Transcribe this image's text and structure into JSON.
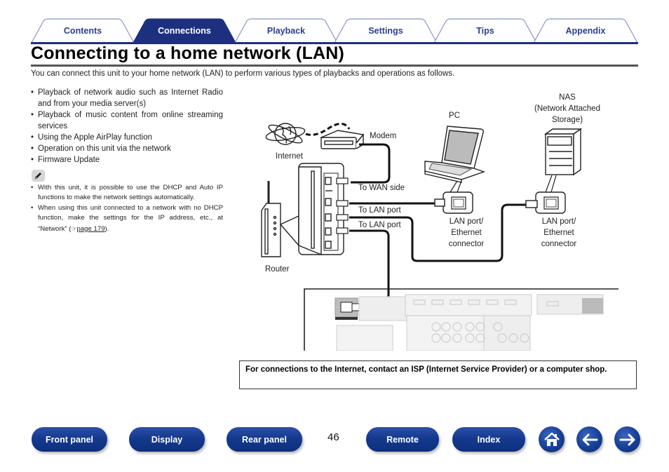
{
  "tabs": [
    {
      "label": "Contents",
      "active": false
    },
    {
      "label": "Connections",
      "active": true
    },
    {
      "label": "Playback",
      "active": false
    },
    {
      "label": "Settings",
      "active": false
    },
    {
      "label": "Tips",
      "active": false
    },
    {
      "label": "Appendix",
      "active": false
    }
  ],
  "colors": {
    "accent": "#1d3080",
    "tab_text": "#2a3f93",
    "tab_border": "#8a93c8"
  },
  "page": {
    "title": "Connecting to a home network (LAN)",
    "intro": "You can connect this unit to your home network (LAN) to perform various types of playbacks and operations as follows.",
    "bullets": [
      "Playback of network audio such as Internet Radio and from your media server(s)",
      "Playback of music content from online streaming services",
      "Using the Apple AirPlay function",
      "Operation on this unit via the network",
      "Firmware Update"
    ],
    "note_icon": "pencil-icon",
    "notes": [
      "With this unit, it is possible to use the DHCP and Auto IP functions to make the network settings automatically.",
      {
        "before": "When using this unit connected to a network with no DHCP function, make the settings for the IP address, etc., at “Network” (",
        "link": "page 179",
        "after": ")."
      }
    ]
  },
  "diagram": {
    "labels": {
      "internet": "Internet",
      "modem": "Modem",
      "router": "Router",
      "to_wan": "To WAN side",
      "to_lan_1": "To LAN port",
      "to_lan_2": "To LAN port",
      "pc": "PC",
      "nas_line1": "NAS",
      "nas_line2": "(Network Attached",
      "nas_line3": "Storage)",
      "pc_port_line1": "LAN port/",
      "pc_port_line2": "Ethernet",
      "pc_port_line3": "connector",
      "nas_port_line1": "LAN port/",
      "nas_port_line2": "Ethernet",
      "nas_port_line3": "connector"
    }
  },
  "notice": "For connections to the Internet, contact an ISP (Internet Service Provider) or a computer shop.",
  "footer": {
    "page_number": "46",
    "buttons": {
      "front_panel": "Front panel",
      "display": "Display",
      "rear_panel": "Rear panel",
      "remote": "Remote",
      "index": "Index"
    },
    "icons": [
      "home-icon",
      "back-arrow-icon",
      "forward-arrow-icon"
    ]
  }
}
